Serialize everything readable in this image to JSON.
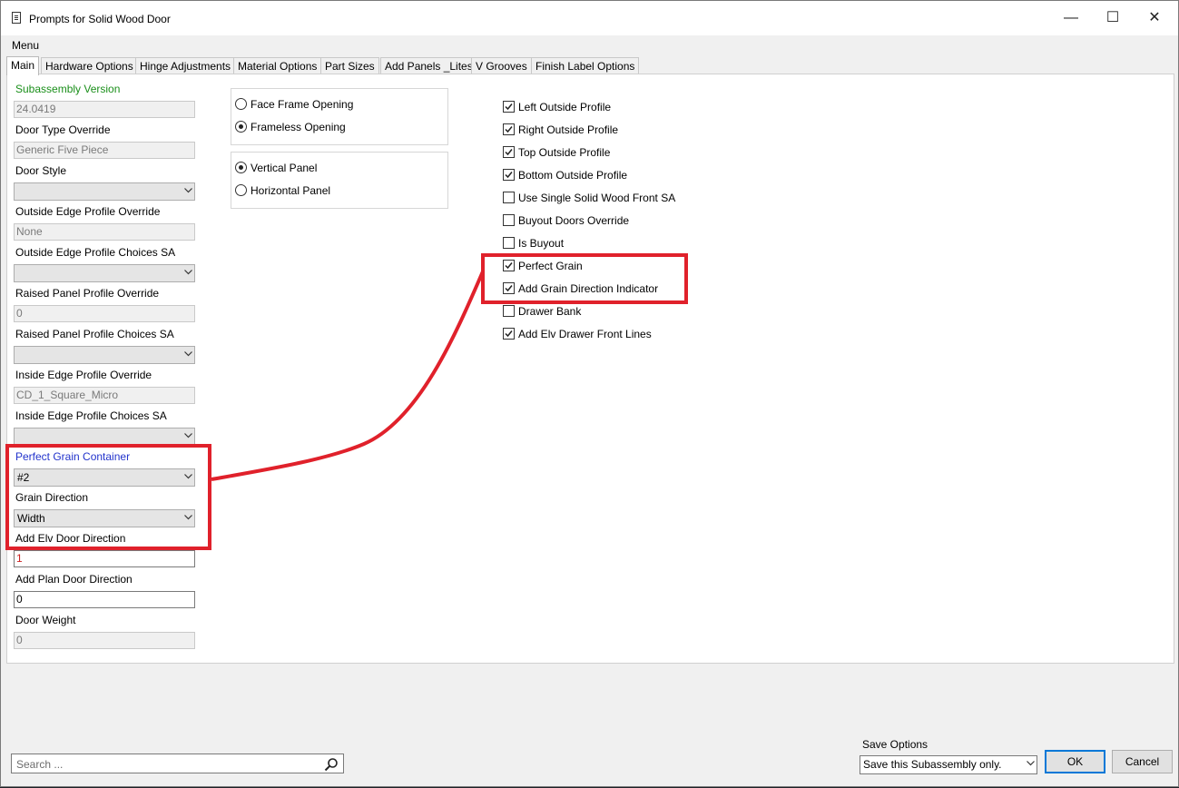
{
  "window": {
    "title": "Prompts for Solid Wood Door",
    "minimize_glyph": "—",
    "maximize_glyph": "☐",
    "close_glyph": "✕"
  },
  "menu": {
    "label": "Menu"
  },
  "tabs": [
    {
      "label": "Main"
    },
    {
      "label": "Hardware Options"
    },
    {
      "label": "Hinge Adjustments"
    },
    {
      "label": "Material Options"
    },
    {
      "label": "Part Sizes"
    },
    {
      "label": "Add Panels _Lites"
    },
    {
      "label": "V Grooves"
    },
    {
      "label": "Finish Label Options"
    }
  ],
  "left": {
    "subassembly_version": {
      "label": "Subassembly Version",
      "value": "24.0419"
    },
    "door_type_override": {
      "label": "Door Type Override",
      "value": "Generic Five Piece"
    },
    "door_style": {
      "label": "Door Style",
      "value": ""
    },
    "outside_edge_profile_override": {
      "label": "Outside Edge Profile Override",
      "value": "None"
    },
    "outside_edge_profile_choices": {
      "label": "Outside Edge Profile Choices SA",
      "value": ""
    },
    "raised_panel_profile_override": {
      "label": "Raised Panel Profile Override",
      "value": "0"
    },
    "raised_panel_profile_choices": {
      "label": "Raised Panel Profile Choices SA",
      "value": ""
    },
    "inside_edge_profile_override": {
      "label": "Inside Edge Profile Override",
      "value": "CD_1_Square_Micro"
    },
    "inside_edge_profile_choices": {
      "label": "Inside Edge Profile Choices SA",
      "value": ""
    },
    "perfect_grain_container": {
      "label": "Perfect Grain Container",
      "value": "#2"
    },
    "grain_direction": {
      "label": "Grain Direction",
      "value": "Width"
    },
    "add_elv_door_direction": {
      "label": "Add Elv Door Direction",
      "value": "1"
    },
    "add_plan_door_direction": {
      "label": "Add Plan Door Direction",
      "value": "0"
    },
    "door_weight": {
      "label": "Door Weight",
      "value": "0"
    }
  },
  "opening_group": {
    "options": [
      {
        "label": "Face Frame Opening",
        "selected": false
      },
      {
        "label": "Frameless Opening",
        "selected": true
      }
    ]
  },
  "panel_group": {
    "options": [
      {
        "label": "Vertical Panel",
        "selected": true
      },
      {
        "label": "Horizontal Panel",
        "selected": false
      }
    ]
  },
  "checkboxes": [
    {
      "label": "Left Outside Profile",
      "checked": true
    },
    {
      "label": "Right Outside Profile",
      "checked": true
    },
    {
      "label": "Top Outside Profile",
      "checked": true
    },
    {
      "label": "Bottom Outside Profile",
      "checked": true
    },
    {
      "label": "Use Single Solid Wood Front SA",
      "checked": false
    },
    {
      "label": "Buyout Doors Override",
      "checked": false
    },
    {
      "label": "Is Buyout",
      "checked": false
    },
    {
      "label": "Perfect Grain",
      "checked": true
    },
    {
      "label": "Add Grain Direction Indicator",
      "checked": true
    },
    {
      "label": "Drawer Bank",
      "checked": false
    },
    {
      "label": "Add Elv Drawer Front Lines",
      "checked": true
    }
  ],
  "footer": {
    "search_placeholder": "Search ...",
    "save_options_label": "Save Options",
    "save_options_value": "Save this Subassembly only.",
    "ok_label": "OK",
    "cancel_label": "Cancel"
  },
  "annotation": {
    "color": "#e0212b"
  }
}
